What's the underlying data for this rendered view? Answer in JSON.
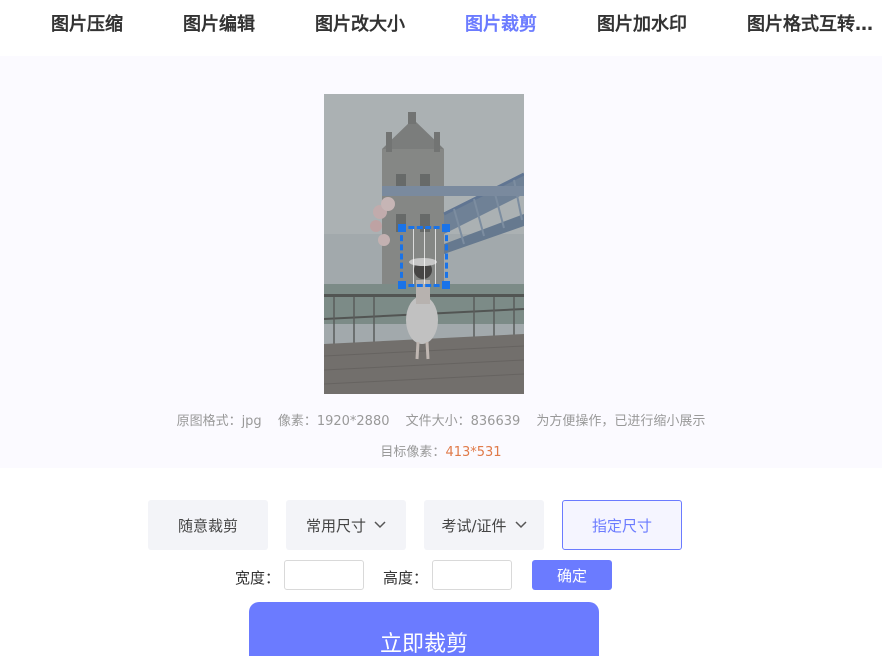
{
  "nav": {
    "items": [
      "图片压缩",
      "图片编辑",
      "图片改大小",
      "图片裁剪",
      "图片加水印",
      "图片格式互转…"
    ],
    "active_index": 3
  },
  "preview": {
    "info": {
      "format": "原图格式：jpg",
      "pixels": "像素：1920*2880",
      "file_size": "文件大小：836639",
      "note": "为方便操作，已进行缩小展示"
    },
    "target_label": "目标像素：",
    "target_value": "413*531"
  },
  "options": {
    "free_crop": "随意裁剪",
    "common_size": "常用尺寸",
    "exam_id": "考试/证件",
    "custom_size": "指定尺寸"
  },
  "size_form": {
    "width_label": "宽度：",
    "height_label": "高度：",
    "width_value": "",
    "height_value": "",
    "confirm_label": "确定"
  },
  "action": {
    "crop_now": "立即裁剪"
  },
  "colors": {
    "accent": "#6b7bff",
    "crop_box": "#1a73e8",
    "target_value": "#e07b4a"
  },
  "icons": [
    "chevron-down-icon"
  ]
}
